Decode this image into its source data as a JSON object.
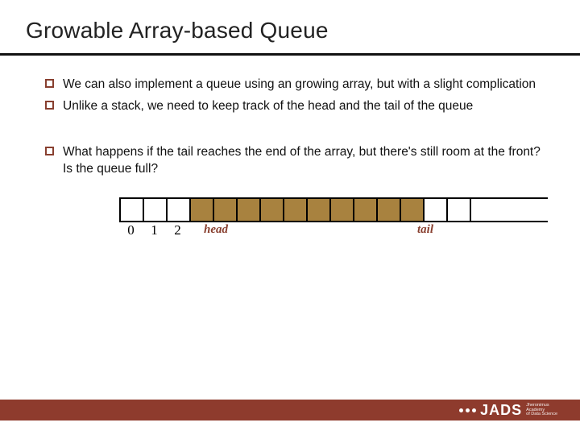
{
  "title": "Growable Array-based Queue",
  "bullets_group1": [
    "We can also implement a queue using an growing array, but with a slight complication",
    "Unlike a stack, we need to keep track of the head and the tail of the queue"
  ],
  "bullets_group2": [
    "What happens if the tail reaches the end of the array, but there's still room at the front? Is the queue full?"
  ],
  "diagram": {
    "indices": [
      "0",
      "1",
      "2"
    ],
    "head_label": "head",
    "tail_label": "tail",
    "cells": [
      "empty",
      "empty",
      "empty",
      "filled",
      "filled",
      "filled",
      "filled",
      "filled",
      "filled",
      "filled",
      "filled",
      "filled",
      "filled",
      "empty",
      "empty"
    ]
  },
  "logo": {
    "text": "JADS",
    "sub1": "Jheronimus",
    "sub2": "Academy",
    "sub3": "of Data Science"
  }
}
